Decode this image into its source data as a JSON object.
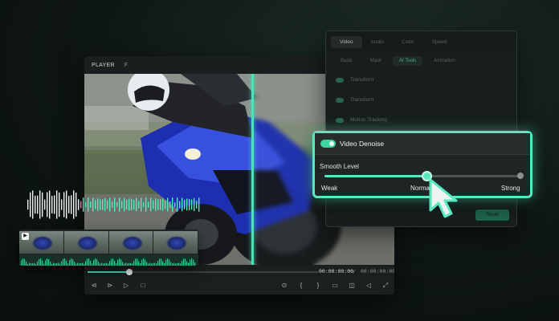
{
  "player": {
    "label": "PLAYER",
    "sub": "F",
    "time_current": "00:00:00:00",
    "time_separator": "/",
    "time_total": "00:00:00:00",
    "progress_fraction": 0.18,
    "controls": [
      "step-back-icon",
      "step-forward-icon",
      "play-icon",
      "stop-icon",
      "settings-icon",
      "mark-in-icon",
      "mark-out-icon",
      "monitor-icon",
      "snapshot-icon",
      "volume-icon",
      "fullscreen-icon"
    ]
  },
  "panel": {
    "tabs": [
      "Video",
      "Audio",
      "Color",
      "Speed"
    ],
    "active_tab": "Video",
    "subtabs": [
      "Basic",
      "Mask",
      "AI Tools",
      "Animation"
    ],
    "active_subtab": "AI Tools",
    "options": [
      "Transform",
      "Transform",
      "Motion Tracking"
    ],
    "button_label": "Reset"
  },
  "denoise": {
    "title": "Video Denoise",
    "enabled": true,
    "smooth_label": "Smooth Level",
    "levels": [
      "Weak",
      "Normal",
      "Strong"
    ],
    "slider_value_fraction": 0.52
  },
  "colors": {
    "accent": "#58e8bf",
    "waveform_pink": "#f07ab0"
  },
  "timeline": {
    "clip_badge": "▶",
    "thumbnail_count": 4
  }
}
